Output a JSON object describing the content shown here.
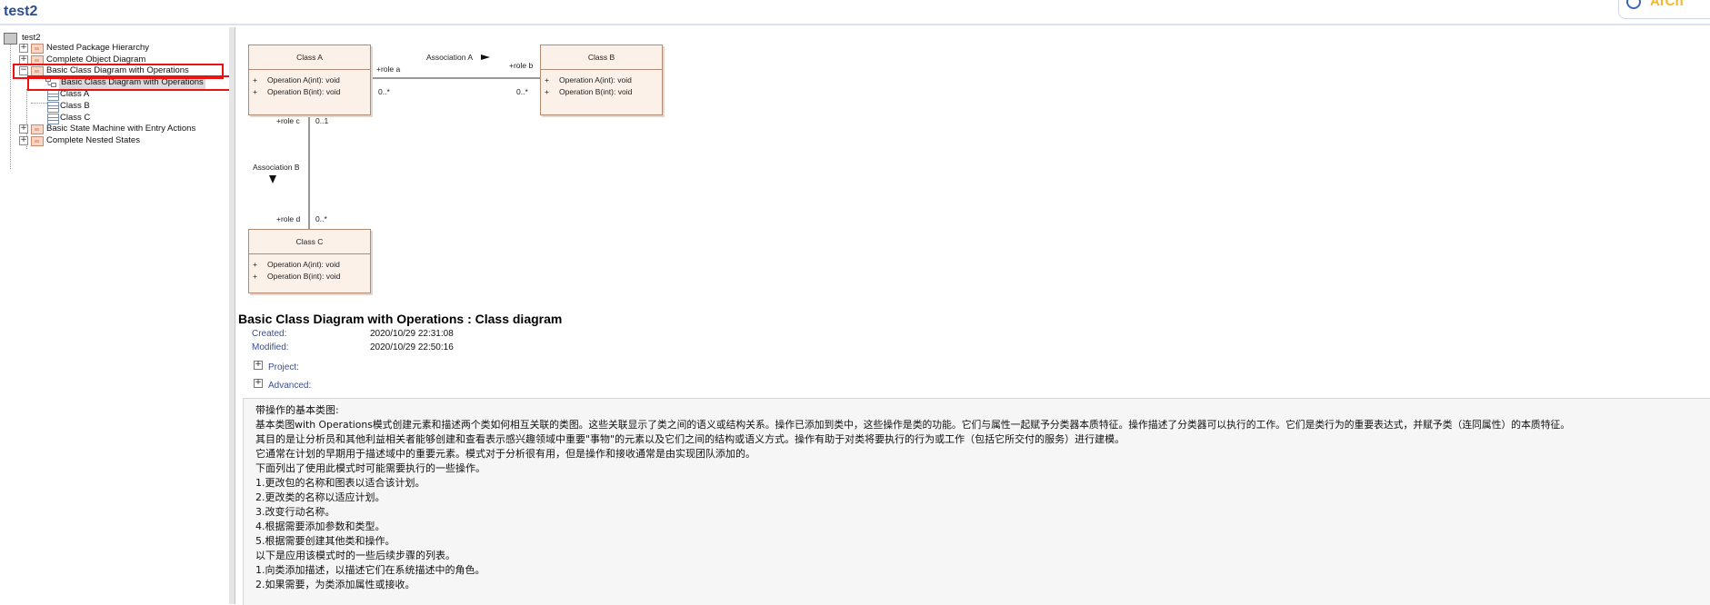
{
  "app": {
    "title": "test2"
  },
  "tree": {
    "root": "test2",
    "items": [
      {
        "label": "Nested Package Hierarchy"
      },
      {
        "label": "Complete Object Diagram"
      },
      {
        "label": "Basic Class Diagram with Operations"
      },
      {
        "label": "Basic Class Diagram with Operations"
      },
      {
        "label": "Class A"
      },
      {
        "label": "Class B"
      },
      {
        "label": "Class C"
      },
      {
        "label": "Basic State Machine with Entry Actions"
      },
      {
        "label": "Complete Nested States"
      }
    ]
  },
  "diagram": {
    "classes": [
      {
        "name": "Class A",
        "ops": [
          "Operation A(int): void",
          "Operation B(int): void"
        ]
      },
      {
        "name": "Class B",
        "ops": [
          "Operation A(int): void",
          "Operation B(int): void"
        ]
      },
      {
        "name": "Class C",
        "ops": [
          "Operation A(int): void",
          "Operation B(int): void"
        ]
      }
    ],
    "op_marker": "+",
    "assoc_a": {
      "name": "Association A",
      "role_a": "+role a",
      "role_b": "+role b",
      "mult_a": "0..*",
      "mult_b": "0..*"
    },
    "assoc_b": {
      "name": "Association B",
      "role_c": "+role c",
      "role_d": "+role d",
      "mult_c": "0..1",
      "mult_d": "0..*"
    }
  },
  "details": {
    "title": "Basic Class Diagram with Operations : Class diagram",
    "created_label": "Created:",
    "created_value": "2020/10/29 22:31:08",
    "modified_label": "Modified:",
    "modified_value": "2020/10/29 22:50:16",
    "project_label": "Project:",
    "advanced_label": "Advanced:",
    "expand_glyph": "+"
  },
  "notes": [
    "带操作的基本类图:",
    "基本类图with Operations模式创建元素和描述两个类如何相互关联的类图。这些关联显示了类之间的语义或结构关系。操作已添加到类中，这些操作是类的功能。它们与属性一起赋予分类器本质特征。操作描述了分类器可以执行的工作。它们是类行为的重要表达式，并赋予类（连同属性）的本质特征。",
    "其目的是让分析员和其他利益相关者能够创建和查看表示感兴趣领域中重要\"事物\"的元素以及它们之间的结构或语义方式。操作有助于对类将要执行的行为或工作（包括它所交付的服务）进行建模。",
    "它通常在计划的早期用于描述域中的重要元素。模式对于分析很有用，但是操作和接收通常是由实现团队添加的。",
    "下面列出了使用此模式时可能需要执行的一些操作。",
    "1.更改包的名称和图表以适合该计划。",
    "2.更改类的名称以适应计划。",
    "3.改变行动名称。",
    "4.根据需要添加参数和类型。",
    "5.根据需要创建其他类和操作。",
    "以下是应用该模式时的一些后续步骤的列表。",
    "1.向类添加描述，以描述它们在系统描述中的角色。",
    "2.如果需要，为类添加属性或接收。"
  ]
}
